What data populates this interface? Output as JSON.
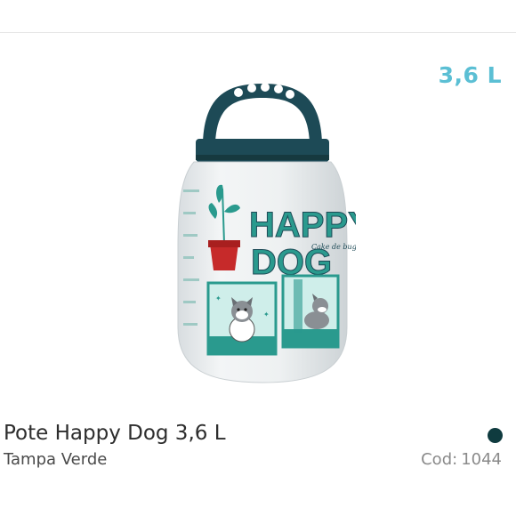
{
  "product": {
    "capacity_badge": "3,6 L",
    "name": "Pote Happy Dog 3,6 L",
    "variant": "Tampa Verde",
    "code_label": "Cod:",
    "code_value": "1044",
    "image": {
      "brand_line1": "HAPPY",
      "brand_line2": "DOG",
      "tagline": "Cake de bugue"
    }
  },
  "colors": {
    "accent": "#5bbfd4",
    "lid": "#1d4a56",
    "print_teal": "#2a9a8e",
    "pot_red": "#c62a2a",
    "swatch": "#0f3b3f"
  },
  "icons": {
    "handle": "jar-handle",
    "dog": "dog-illustration",
    "plant": "potted-plant"
  }
}
